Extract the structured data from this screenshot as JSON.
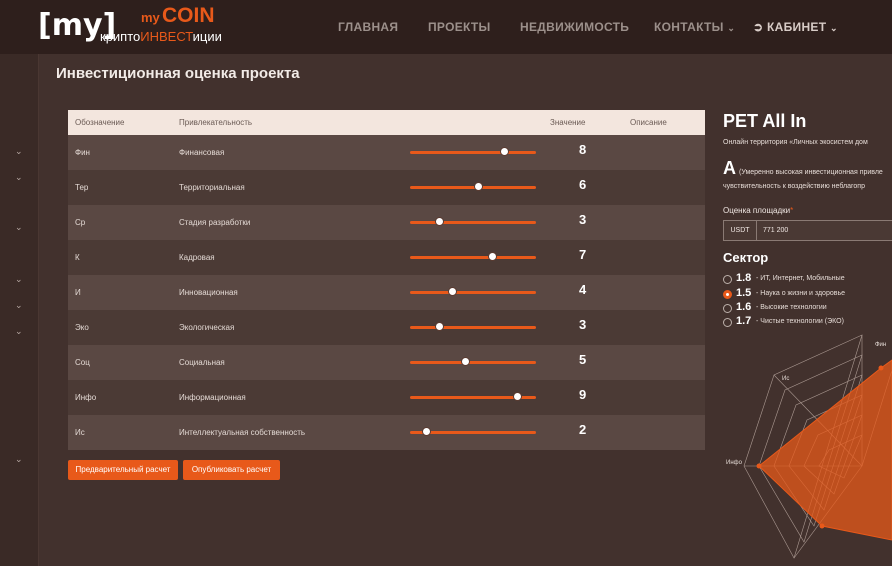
{
  "header": {
    "logo_text": "[my]",
    "brand_my": "my",
    "brand_coin": "COIN",
    "tagline_a": "крипто",
    "tagline_b": "ИНВЕСТ",
    "tagline_c": "иции",
    "nav": [
      "ГЛАВНАЯ",
      "ПРОЕКТЫ",
      "НЕДВИЖИМОСТЬ",
      "КОНТАКТЫ",
      "КАБИНЕТ"
    ]
  },
  "page_title": "Инвестиционная оценка проекта",
  "table": {
    "headers": {
      "designation": "Обозначение",
      "attractiveness": "Привлекательность",
      "value": "Значение",
      "description": "Описание"
    },
    "rows": [
      {
        "code": "Фин",
        "name": "Финансовая",
        "value": "8"
      },
      {
        "code": "Тер",
        "name": "Территориальная",
        "value": "6"
      },
      {
        "code": "Ср",
        "name": "Стадия разработки",
        "value": "3"
      },
      {
        "code": "К",
        "name": "Кадровая",
        "value": "7"
      },
      {
        "code": "И",
        "name": "Инновационная",
        "value": "4"
      },
      {
        "code": "Эко",
        "name": "Экологическая",
        "value": "3"
      },
      {
        "code": "Соц",
        "name": "Социальная",
        "value": "5"
      },
      {
        "code": "Инфо",
        "name": "Информационная",
        "value": "9"
      },
      {
        "code": "Ис",
        "name": "Интеллектуальная собственность",
        "value": "2"
      }
    ]
  },
  "buttons": {
    "preliminary": "Предварительный расчет",
    "publish": "Опубликовать расчет"
  },
  "panel": {
    "title": "PET All In",
    "subtitle": "Онлайн территория «Личных экосистем дом",
    "grade": "A",
    "grade_desc_1": "(Умеренно высокая инвестиционная привле",
    "grade_desc_2": "чувствительность к воздействию неблагопр",
    "field_label": "Оценка площадки",
    "required_mark": "*",
    "currency": "USDT",
    "amount": "771 200",
    "sector_title": "Сектор",
    "sectors": [
      {
        "num": "1.8",
        "label": "- ИТ, Интернет, Мобильные"
      },
      {
        "num": "1.5",
        "label": "- Наука о жизни и здоровье"
      },
      {
        "num": "1.6",
        "label": "- Высокие технологии"
      },
      {
        "num": "1.7",
        "label": "- Чистые технологии (ЭКО)"
      }
    ],
    "selected_sector": 1
  },
  "radar": {
    "labels": {
      "fin": "Фин",
      "is": "Ис",
      "info": "Инфо"
    }
  },
  "colors": {
    "accent": "#e8591a",
    "background": "#42312d",
    "header": "#2e1f1c"
  }
}
